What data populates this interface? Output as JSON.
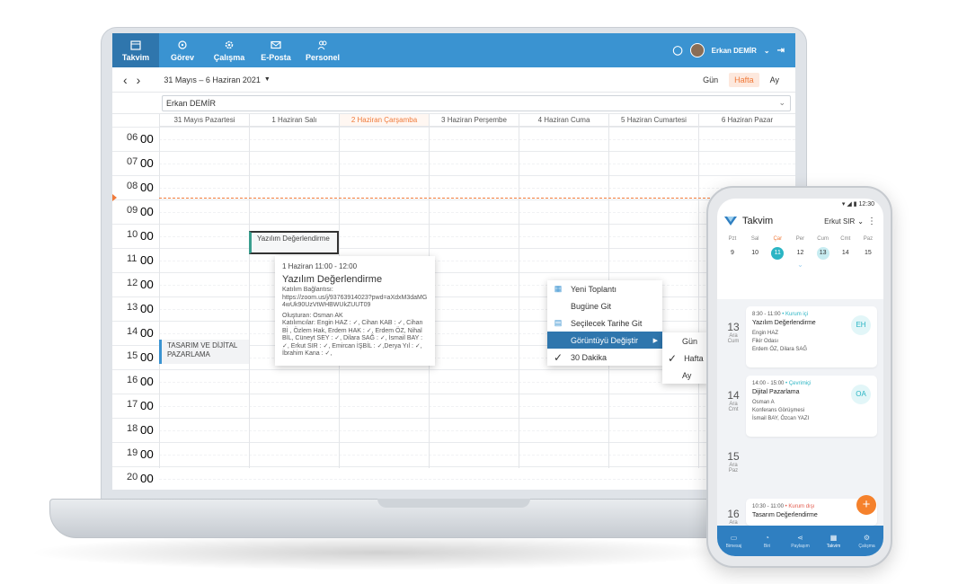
{
  "nav": {
    "items": [
      {
        "label": "Takvim",
        "icon": "calendar-icon"
      },
      {
        "label": "Görev",
        "icon": "target-icon"
      },
      {
        "label": "Çalışma",
        "icon": "gear-icon"
      },
      {
        "label": "E-Posta",
        "icon": "mail-icon"
      },
      {
        "label": "Personel",
        "icon": "people-icon"
      }
    ],
    "user": "Erkan DEMİR"
  },
  "toolbar": {
    "range": "31 Mayıs – 6 Haziran 2021",
    "views": [
      "Gün",
      "Hafta",
      "Ay"
    ],
    "active_view": "Hafta"
  },
  "person_select": {
    "value": "Erkan DEMİR"
  },
  "days": [
    "31 Mayıs Pazartesi",
    "1 Haziran Salı",
    "2 Haziran Çarşamba",
    "3 Haziran Perşembe",
    "4 Haziran Cuma",
    "5 Haziran Cumartesi",
    "6 Haziran Pazar"
  ],
  "hours": [
    "06",
    "07",
    "08",
    "09",
    "10",
    "11",
    "12",
    "13",
    "14",
    "15",
    "16",
    "17",
    "18",
    "19",
    "20"
  ],
  "minutes": "00",
  "events": [
    {
      "title": "Yazılım Değerlendirme"
    },
    {
      "title": "TASARIM VE DİJİTAL PAZARLAMA"
    }
  ],
  "popup": {
    "time": "1 Haziran 11:00 - 12:00",
    "title": "Yazılım Değerlendirme",
    "link_label": "Katılım Bağlantısı:",
    "link": "https://zoom.us/j/93763914023?pwd=aXdxM3daMG4wUk90UzVtWHBWUkZUUT09",
    "creator": "Oluşturan: Osman AK",
    "participants": "Katılımcılar: Engin HAZ : ✓, Cihan KAB : ✓, Cihan Bİ , Özlem Hak, Erdem HAK : ✓, Erdem ÖZ, Nihal BİL, Cüneyt SEY : ✓, Dilara SAĞ : ✓, İsmail BAY : ✓, Erkut SIR : ✓, Emircan İŞBİL : ✓,Derya Yıl : ✓, İbrahim Kana : ✓,"
  },
  "context_menu": {
    "items": [
      "Yeni Toplantı",
      "Bugüne Git",
      "Seçilecek Tarihe Git",
      "Görüntüyü Değiştir",
      "30 Dakika"
    ],
    "submenu": [
      "Gün",
      "Hafta",
      "Ay"
    ]
  },
  "phone": {
    "time": "12:30",
    "title": "Takvim",
    "user": "Erkut SIR",
    "weekdays": [
      "Pzt",
      "Sal",
      "Çar",
      "Per",
      "Cum",
      "Cmt",
      "Paz"
    ],
    "dates": [
      "9",
      "10",
      "11",
      "12",
      "13",
      "14",
      "15"
    ],
    "cards": [
      {
        "day": "13",
        "month": "Ara",
        "dow": "Cum",
        "time": "8:30 - 11:00",
        "tag": "• Kurum içi",
        "title": "Yazılım Değerlendirme",
        "l1": "Engin HAZ",
        "l2": "Fikir Odası",
        "l3": "Erdem ÖZ, Dilara SAĞ",
        "badge": "EH"
      },
      {
        "day": "14",
        "month": "Ara",
        "dow": "Cmt",
        "time": "14:00 - 15:00",
        "tag": "• Çevrimiçi",
        "title": "Dijital Pazarlama",
        "l1": "Osman A",
        "l2": "Konferans Görüşmesi",
        "l3": "İsmail BAY, Özcan YAZI",
        "badge": "OA"
      },
      {
        "day": "15",
        "month": "Ara",
        "dow": "Paz"
      },
      {
        "day": "16",
        "month": "Ara",
        "time": "10:30 - 11:00",
        "tag": "• Kurum dışı",
        "title": "Tasarım Değerlendirme"
      }
    ],
    "tabs": [
      "Bimesaj",
      "Biri",
      "Paylaşım",
      "Takvim",
      "Çalışma"
    ]
  }
}
